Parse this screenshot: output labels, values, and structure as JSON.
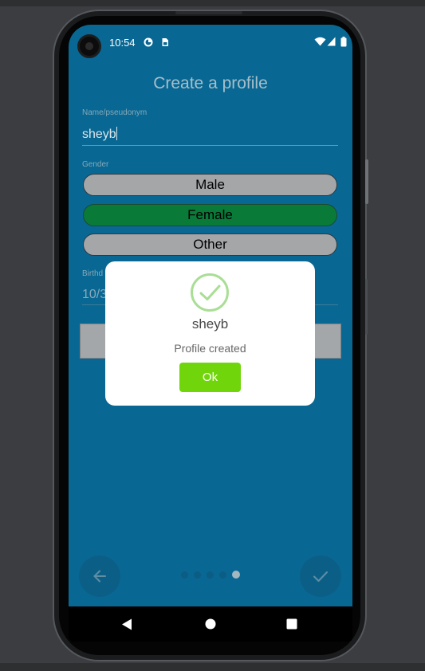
{
  "status_bar": {
    "time": "10:54",
    "left_icons": [
      "sync-icon",
      "sim-icon"
    ],
    "right_icons": [
      "wifi-icon",
      "signal-icon",
      "battery-icon"
    ]
  },
  "form": {
    "title": "Create a profile",
    "name_label": "Name/pseudonym",
    "name_value": "sheyb",
    "gender_label": "Gender",
    "gender_options": [
      "Male",
      "Female",
      "Other"
    ],
    "selected_gender": "Female",
    "birth_label_visible": "Birthd",
    "birth_value_visible": "10/3"
  },
  "pager": {
    "pages": 5,
    "current_page": 5,
    "back_icon": "arrow-left-icon",
    "done_icon": "check-icon"
  },
  "nav_bar": {
    "icons": [
      "back-triangle-icon",
      "home-circle-icon",
      "recents-square-icon"
    ]
  },
  "dialog": {
    "icon": "check-circle-icon",
    "name": "sheyb",
    "message": "Profile created",
    "ok_label": "Ok"
  },
  "colors": {
    "screen_background": "#096793",
    "selected_option": "#0a7a39",
    "unselected_option": "#a4a6a8",
    "dialog_check": "#9fdc8a",
    "ok_button": "#70d60b"
  }
}
